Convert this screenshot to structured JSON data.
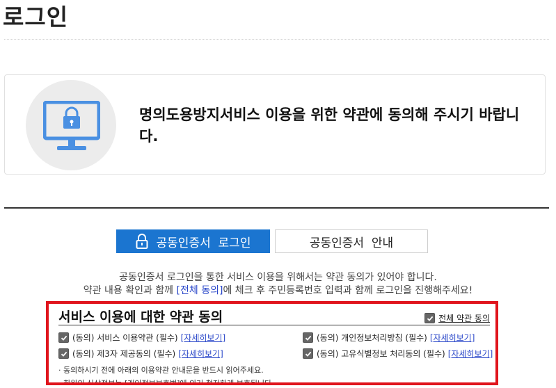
{
  "page": {
    "title": "로그인"
  },
  "notice": {
    "message": "명의도용방지서비스 이용을 위한 약관에 동의해 주시기 바랍니다.",
    "icon": "monitor-lock-icon",
    "accent": "#4a90e2"
  },
  "tabs": [
    {
      "label": "공동인증서  로그인",
      "active": true,
      "icon": "lock-icon"
    },
    {
      "label": "공동인증서  안내",
      "active": false
    }
  ],
  "intro": {
    "line1": "공동인증서 로그인을 통한 서비스 이용을 위해서는 약관 동의가 있어야 합니다.",
    "line2_prefix": "약관 내용 확인과 함께 ",
    "line2_link": "[전체 동의]",
    "line2_suffix": "에 체크 후 주민등록번호 입력과 함께 로그인을 진행해주세요!"
  },
  "terms": {
    "title": "서비스 이용에 대한 약관 동의",
    "all_agree_label": "전체 약관 동의",
    "detail_label": "[자세히보기]",
    "items": [
      {
        "label": "(동의) 서비스 이용약관 (필수)",
        "checked": true
      },
      {
        "label": "(동의) 개인정보처리방침 (필수)",
        "checked": true
      },
      {
        "label": "(동의) 제3자 제공동의 (필수)",
        "checked": true
      },
      {
        "label": "(동의) 고유식별정보 처리동의 (필수)",
        "checked": true
      }
    ],
    "note1": "· 동의하시기 전에 아래의 이용약관 안내문을 반드시 읽어주세요.",
    "note2": "· 회원의 신상정보는 [개인정보보호법]에 의거 철저하게 보호됩니다."
  },
  "colors": {
    "primary": "#1b75d0",
    "highlight_border": "#e0151d",
    "link": "#2a47c9"
  }
}
